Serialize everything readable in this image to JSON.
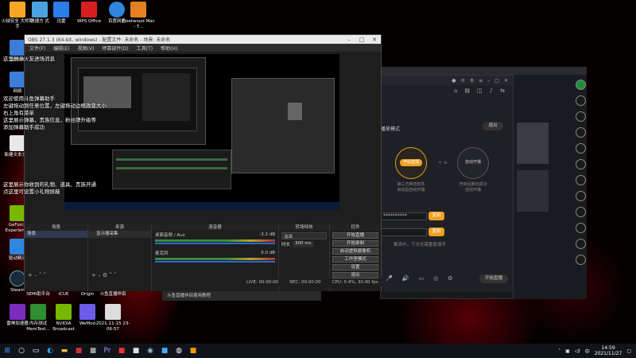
{
  "desktop": {
    "icons": [
      {
        "label": "火绒安全\n大师助手",
        "color": "#f6a623",
        "glyph": "🔥"
      },
      {
        "label": "快捷方\n式",
        "color": "#4aa3df",
        "glyph": "▦"
      },
      {
        "label": "迅雷",
        "color": "#2b7de9",
        "glyph": "➤"
      },
      {
        "label": "WPS Office",
        "color": "#d71e1e",
        "glyph": "W"
      },
      {
        "label": "百度网盘",
        "color": "#2e86de",
        "glyph": "☁"
      },
      {
        "label": "Fleetwood\nMac - T...",
        "color": "#e67e22",
        "glyph": "♪"
      }
    ],
    "left_icons": [
      {
        "label": "此电脑",
        "color": "#3b7dd8"
      },
      {
        "label": "网络",
        "color": "#3b7dd8"
      },
      {
        "label": "新建文本文档",
        "color": "#e8e8e8"
      },
      {
        "label": "GeForce\nExperience",
        "color": "#76b900"
      },
      {
        "label": "驱动精灵",
        "color": "#2e86de"
      },
      {
        "label": "Steam",
        "color": "#1b2838"
      },
      {
        "label": "雷神加速器",
        "color": "#7b2cbf"
      }
    ],
    "bottom_icons": [
      {
        "label": "SEMI助平台",
        "color": "#333"
      },
      {
        "label": "iCUE",
        "color": "#111"
      },
      {
        "label": "Origin",
        "color": "#f56c2d"
      },
      {
        "label": "斗鱼直播伴侣",
        "color": "#ff6d00"
      },
      {
        "label": "内存测试\nMemTest...",
        "color": "#2d8f2d"
      },
      {
        "label": "NVIDIA\nBroadcast",
        "color": "#76b900"
      },
      {
        "label": "WeMod",
        "color": "#6c5ce7"
      },
      {
        "label": "2021-11-15\n23-06-57",
        "color": "#ddd"
      }
    ]
  },
  "notes": {
    "top": "这里展示火友进场消息",
    "middle": [
      "欢迎使用斗鱼弹幕助手",
      "左键拖动到任意位置，左键拖动边框改变大小",
      "右上角有菜单",
      "这里展示弹幕，贵族信息，粉丝牌升级等",
      "添加弹幕助手成功"
    ],
    "bottom": [
      "这里展示你收到的礼物、道具、贵族开通",
      "点这里可设置小礼物屏蔽"
    ]
  },
  "obs": {
    "title": "OBS 27.1.3 (64-bit, windows) - 配置文件: 未命名 - 场景: 未命名",
    "menu": [
      "文件(F)",
      "编辑(E)",
      "视图(V)",
      "停靠部件(D)",
      "工具(T)",
      "帮助(H)"
    ],
    "docks": {
      "scenes": "场景",
      "sources": "来源",
      "mixer": "混音器",
      "transitions": "转场特效",
      "controls": "控件"
    },
    "scene_item": "场景",
    "sources": [
      "显示器采集"
    ],
    "mixer_channels": [
      {
        "name": "桌面音频 / Aux",
        "db": "-3.2 dB"
      },
      {
        "name": "麦克风",
        "db": "0.0 dB"
      }
    ],
    "transition": {
      "type": "淡出",
      "duration_label": "时长",
      "duration": "300 ms"
    },
    "controls": [
      "开始直播",
      "开始录制",
      "启动虚拟摄像机",
      "工作室模式",
      "设置",
      "退出"
    ],
    "status": {
      "live": "LIVE: 00:00:00",
      "rec": "REC: 00:00:00",
      "cpu": "CPU: 0.4%, 30.00 fps"
    },
    "live_tab": "斗鱼直播伴侣",
    "live_hint": "斗鱼直播伴侣使用教程"
  },
  "douyu": {
    "mode_label": "播放模式",
    "exit_label": "退出",
    "left_circle": {
      "title": "开始直播",
      "sub": "第三方推流软件\n启动后自动开播"
    },
    "right_circle": {
      "title": "自动开播",
      "sub": "开启后推流成功\n自动开播"
    },
    "field1": "**********",
    "btn1": "复制",
    "btn2": "复制",
    "hint": "推流中，下次无需重复填写",
    "start_btn": "开始直播"
  },
  "taskbar": {
    "time": "14:59",
    "date": "2021/11/27",
    "lang": "中"
  }
}
